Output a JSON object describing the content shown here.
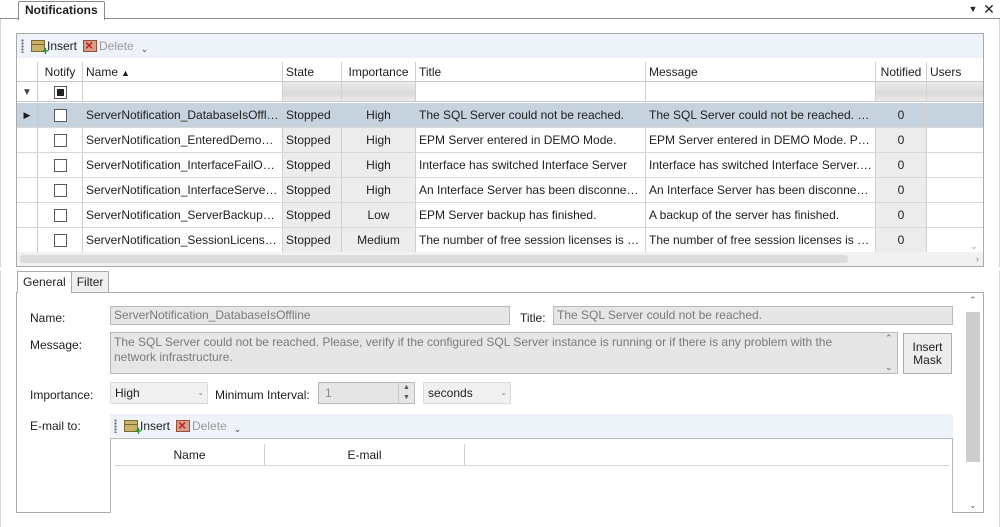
{
  "window": {
    "tab_title": "Notifications",
    "menu_glyph": "▼",
    "close_glyph": "✕"
  },
  "toolbar": {
    "insert_label": "Insert",
    "delete_label": "Delete",
    "overflow_glyph": "⌄"
  },
  "grid": {
    "columns": {
      "notify": "Notify",
      "name": "Name",
      "state": "State",
      "importance": "Importance",
      "title": "Title",
      "message": "Message",
      "notified": "Notified",
      "users": "Users"
    },
    "sort_glyph": "▲",
    "filter_glyph": "▼",
    "row_pointer_glyph": "▶",
    "rows": [
      {
        "name": "ServerNotification_DatabaseIsOffline",
        "state": "Stopped",
        "importance": "High",
        "title": "The SQL Server could not be reached.",
        "message": "The SQL Server could not be reached. Ple...",
        "notified": "0"
      },
      {
        "name": "ServerNotification_EnteredDemoM...",
        "state": "Stopped",
        "importance": "High",
        "title": "EPM Server entered in DEMO Mode.",
        "message": "EPM Server entered in DEMO Mode. Plea...",
        "notified": "0"
      },
      {
        "name": "ServerNotification_InterfaceFailOve...",
        "state": "Stopped",
        "importance": "High",
        "title": "Interface has switched Interface Server",
        "message": "Interface has switched Interface Server. T...",
        "notified": "0"
      },
      {
        "name": "ServerNotification_InterfaceServerD...",
        "state": "Stopped",
        "importance": "High",
        "title": "An Interface Server has been disconnecte...",
        "message": "An Interface Server has been disconnecte...",
        "notified": "0"
      },
      {
        "name": "ServerNotification_ServerBackupDo...",
        "state": "Stopped",
        "importance": "Low",
        "title": "EPM Server backup has finished.",
        "message": "A backup of the server has finished.",
        "notified": "0"
      },
      {
        "name": "ServerNotification_SessionLicensesI...",
        "state": "Stopped",
        "importance": "Medium",
        "title": "The number of free session licenses is ne...",
        "message": "The number of free session licenses is ne...",
        "notified": "0"
      }
    ]
  },
  "detail": {
    "tabs": [
      "General",
      "Filter"
    ],
    "name_label": "Name:",
    "name_value": "ServerNotification_DatabaseIsOffline",
    "title_label": "Title:",
    "title_value": "The SQL Server could not be reached.",
    "message_label": "Message:",
    "message_value": "The SQL Server could not be reached. Please, verify if the configured SQL Server instance is running or if there is any problem with the network infrastructure.",
    "insert_mask_label": "Insert Mask",
    "importance_label": "Importance:",
    "importance_value": "High",
    "min_interval_label": "Minimum Interval:",
    "min_interval_value": "1",
    "interval_unit": "seconds",
    "email_label": "E-mail to:",
    "email_columns": {
      "name": "Name",
      "email": "E-mail"
    }
  }
}
